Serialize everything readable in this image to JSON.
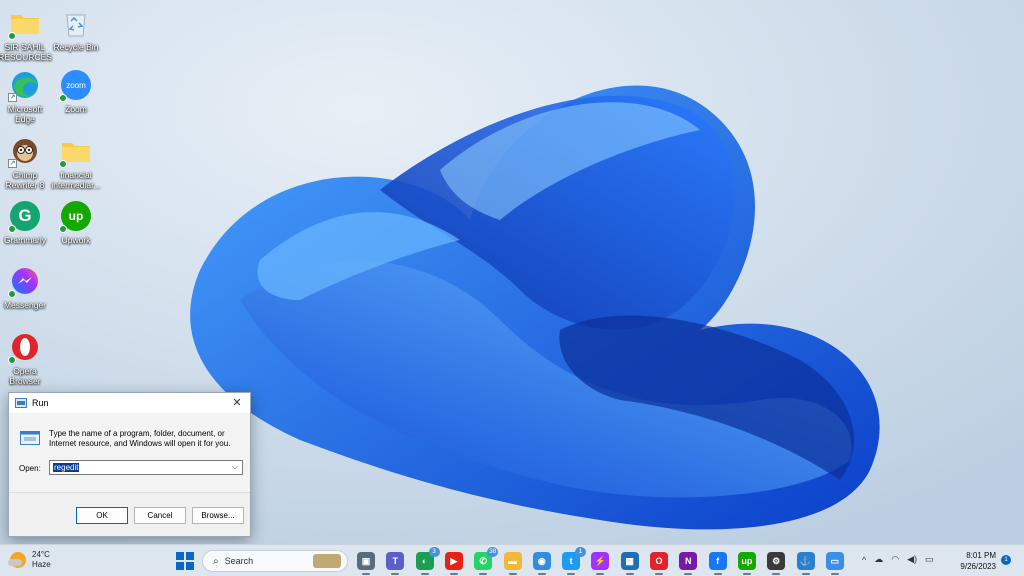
{
  "desktop": {
    "icons": [
      {
        "label": "SIR SAHIL RESOURCES",
        "icon": "folder-icon"
      },
      {
        "label": "Recycle Bin",
        "icon": "recycle-bin-icon"
      },
      {
        "label": "Microsoft Edge",
        "icon": "edge-icon"
      },
      {
        "label": "Zoom",
        "icon": "zoom-icon",
        "glyph": "zoom"
      },
      {
        "label": "Chimp Rewriter 8",
        "icon": "chimp-icon"
      },
      {
        "label": "financial intermediar...",
        "icon": "folder-icon"
      },
      {
        "label": "Grammarly",
        "icon": "grammarly-icon",
        "glyph": "G"
      },
      {
        "label": "Upwork",
        "icon": "upwork-icon",
        "glyph": "up"
      },
      {
        "label": "Messenger",
        "icon": "messenger-icon"
      },
      {
        "label": "Opera Browser",
        "icon": "opera-icon"
      }
    ]
  },
  "run_dialog": {
    "title": "Run",
    "description": "Type the name of a program, folder, document, or Internet resource, and Windows will open it for you.",
    "open_label": "Open:",
    "open_value": "regedit",
    "ok_label": "OK",
    "cancel_label": "Cancel",
    "browse_label": "Browse...",
    "close_glyph": "✕"
  },
  "taskbar": {
    "weather_temp": "24°C",
    "weather_desc": "Haze",
    "search_placeholder": "Search",
    "apps": [
      {
        "name": "task-view",
        "color": "#5a6b7c",
        "glyph": "▣"
      },
      {
        "name": "teams-chat",
        "color": "#5b5fc7",
        "glyph": "T"
      },
      {
        "name": "chrome-profile",
        "color": "#1a9e52",
        "glyph": "◐",
        "badge": "3"
      },
      {
        "name": "youtube",
        "color": "#e62117",
        "glyph": "▶"
      },
      {
        "name": "whatsapp",
        "color": "#25d366",
        "glyph": "✆",
        "badge": "38"
      },
      {
        "name": "file-explorer",
        "color": "#f2b83a",
        "glyph": "▬"
      },
      {
        "name": "chrome",
        "color": "#2f8ee0",
        "glyph": "◉"
      },
      {
        "name": "twitter",
        "color": "#1d9bf0",
        "glyph": "t",
        "badge": "1"
      },
      {
        "name": "messenger",
        "color": "#a033ff",
        "glyph": "⚡"
      },
      {
        "name": "store",
        "color": "#1f6fb2",
        "glyph": "▦"
      },
      {
        "name": "opera",
        "color": "#e0242c",
        "glyph": "O"
      },
      {
        "name": "onenote",
        "color": "#7719aa",
        "glyph": "N"
      },
      {
        "name": "facebook",
        "color": "#1877f2",
        "glyph": "f"
      },
      {
        "name": "upwork",
        "color": "#14a800",
        "glyph": "up"
      },
      {
        "name": "settings",
        "color": "#3a3a3a",
        "glyph": "⚙"
      },
      {
        "name": "network-tool",
        "color": "#2a7fd4",
        "glyph": "⚓"
      },
      {
        "name": "run",
        "color": "#3a8ee6",
        "glyph": "▭"
      }
    ],
    "tray_chevron": "^",
    "time": "8:01 PM",
    "date": "9/26/2023",
    "notification_count": "1"
  }
}
